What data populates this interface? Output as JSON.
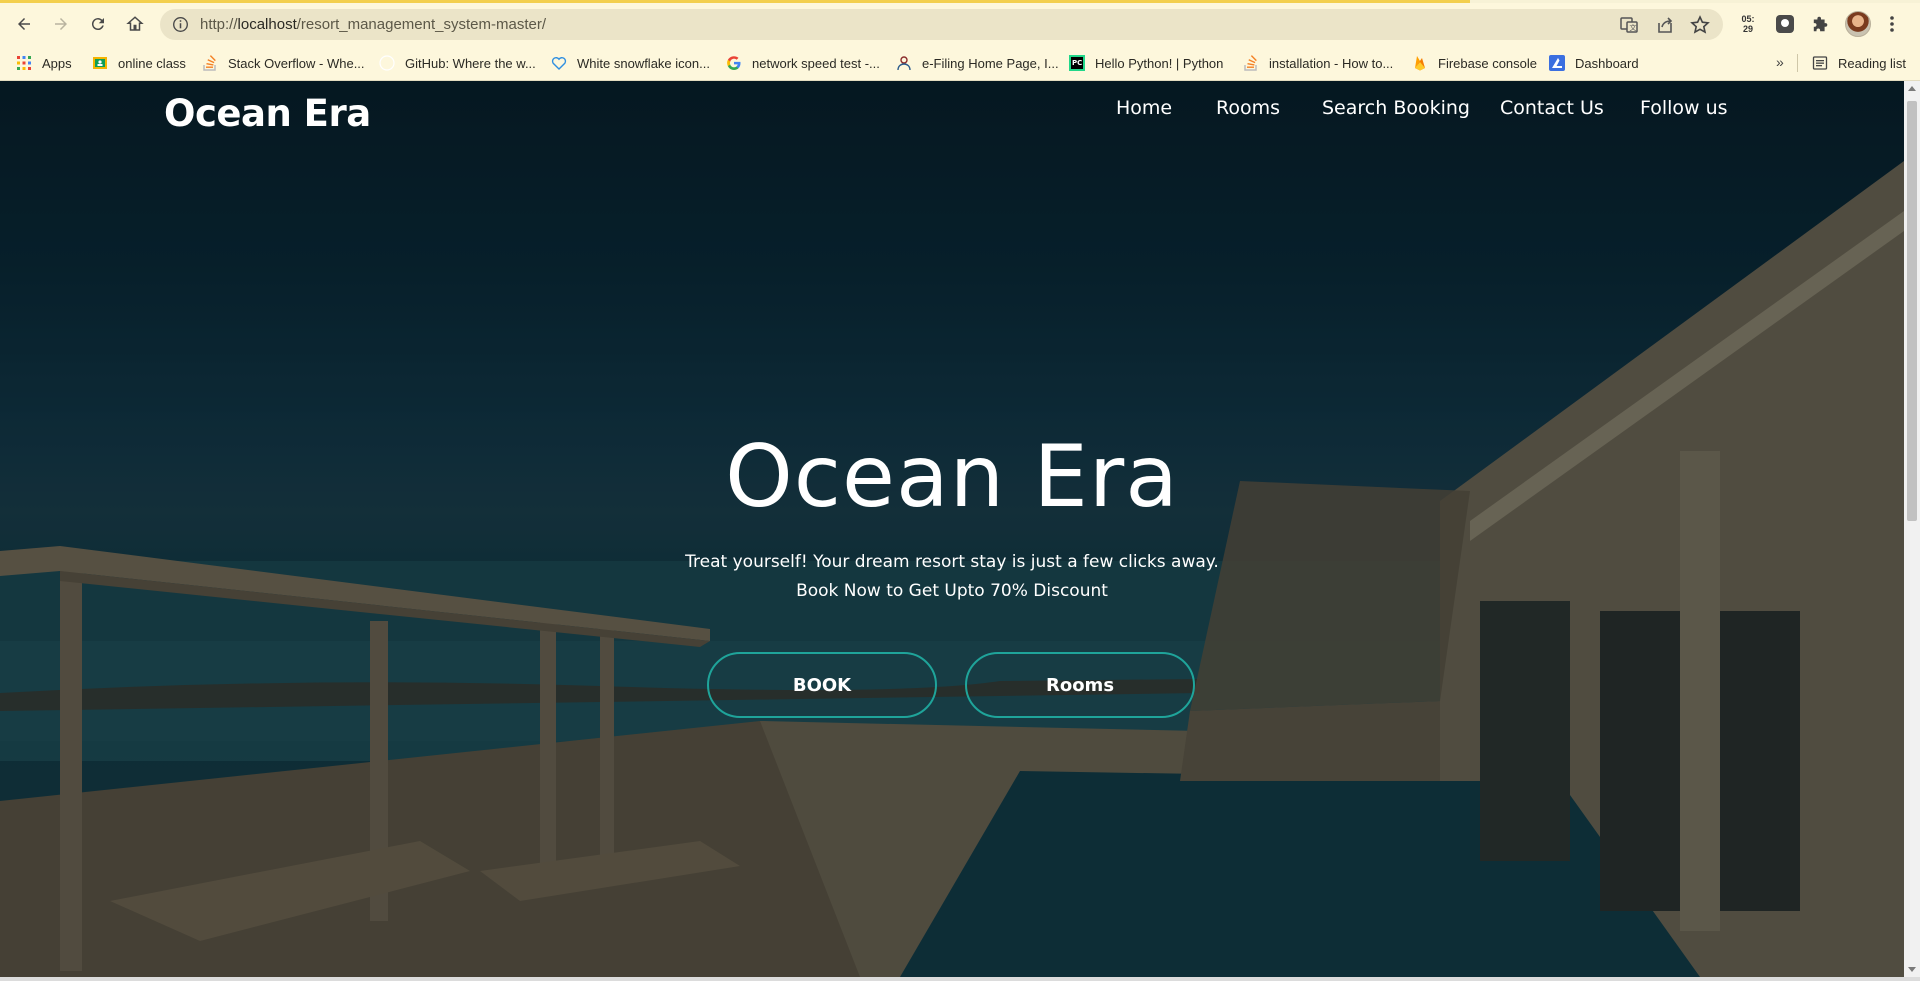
{
  "browser": {
    "url_prefix": "http://",
    "url_host": "localhost",
    "url_path": "/resort_management_system-master/",
    "clock_top": "05:",
    "clock_bottom": "29",
    "reading_list": "Reading list",
    "more_bookmarks": "»"
  },
  "bookmarks": [
    {
      "label": "Apps",
      "icon": "apps-grid-icon"
    },
    {
      "label": "online class",
      "icon": "classroom-icon"
    },
    {
      "label": "Stack Overflow - Whe...",
      "icon": "stackoverflow-icon"
    },
    {
      "label": "GitHub: Where the w...",
      "icon": "github-icon"
    },
    {
      "label": "White snowflake icon...",
      "icon": "heart-icon"
    },
    {
      "label": "network speed test -...",
      "icon": "google-icon"
    },
    {
      "label": "e-Filing Home Page, I...",
      "icon": "efiling-icon"
    },
    {
      "label": "Hello Python! | Python",
      "icon": "pycharm-icon"
    },
    {
      "label": "installation - How to...",
      "icon": "stackoverflow-icon"
    },
    {
      "label": "Firebase console",
      "icon": "firebase-icon"
    },
    {
      "label": "Dashboard",
      "icon": "dashboard-icon"
    }
  ],
  "site": {
    "brand": "Ocean Era",
    "nav": [
      "Home",
      "Rooms",
      "Search Booking",
      "Contact Us",
      "Follow us"
    ],
    "hero_title": "Ocean Era",
    "hero_line1": "Treat yourself! Your dream resort stay is just a few clicks away.",
    "hero_line2": "Book Now to Get Upto 70% Discount",
    "btn_book": "BOOK",
    "btn_rooms": "Rooms",
    "accent_color": "#1fa49a"
  }
}
